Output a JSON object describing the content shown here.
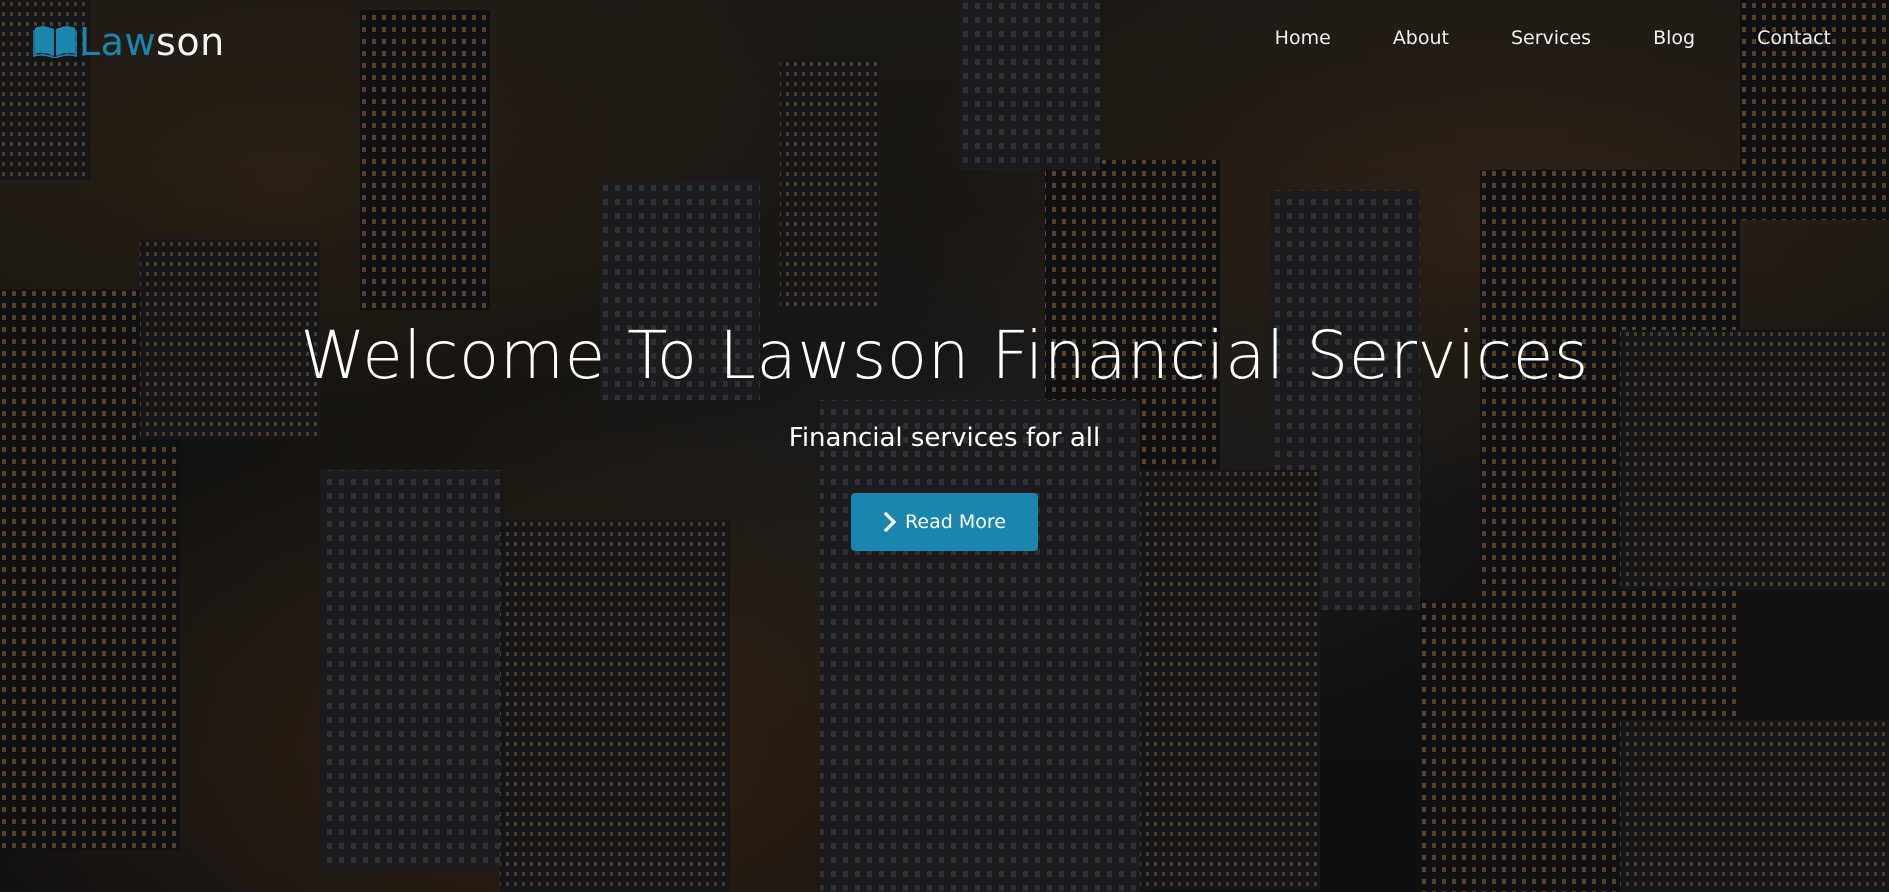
{
  "brand": {
    "logo_accent": "Law",
    "logo_rest": "son",
    "accent_color": "#1b86ad"
  },
  "nav": {
    "items": [
      {
        "label": "Home"
      },
      {
        "label": "About"
      },
      {
        "label": "Services"
      },
      {
        "label": "Blog"
      },
      {
        "label": "Contact"
      }
    ]
  },
  "hero": {
    "title": "Welcome To Lawson Financial Services",
    "subtitle": "Financial services for all",
    "cta_label": "Read More",
    "cta_icon": "chevron-right-icon",
    "background": "night city skyline"
  },
  "icons": {
    "logo": "open-book-icon"
  }
}
